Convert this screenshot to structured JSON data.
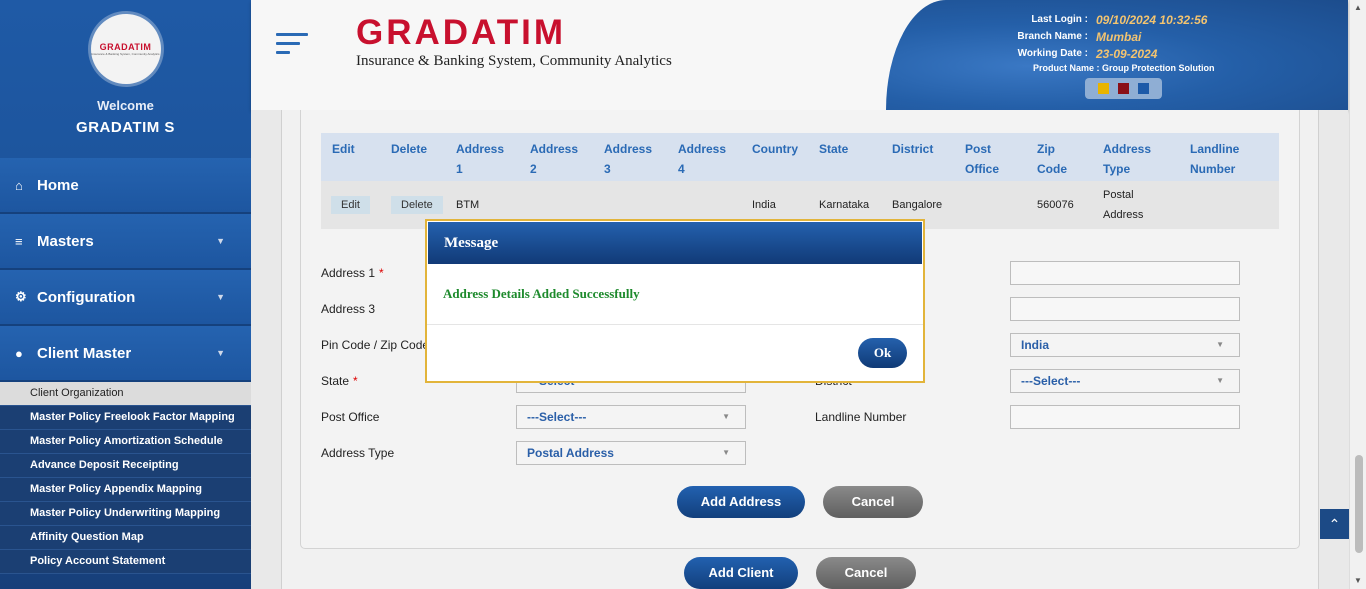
{
  "sidebar": {
    "logo_text": "GRADATIM",
    "logo_sub": "Insurance & Banking System, Community Analytics",
    "welcome": "Welcome",
    "username": "GRADATIM S",
    "nav": [
      {
        "label": "Home",
        "icon": "home-icon"
      },
      {
        "label": "Masters",
        "icon": "database-icon"
      },
      {
        "label": "Configuration",
        "icon": "gears-icon"
      },
      {
        "label": "Client Master",
        "icon": "user-icon"
      }
    ],
    "submenu": [
      "Client Organization",
      "Master Policy Freelook Factor Mapping",
      "Master Policy Amortization Schedule",
      "Advance Deposit Receipting",
      "Master Policy Appendix Mapping",
      "Master Policy Underwriting Mapping",
      "Affinity Question Map",
      "Policy Account Statement"
    ]
  },
  "header": {
    "brand": "GRADATIM",
    "tagline": "Insurance & Banking System, Community Analytics",
    "last_login_label": "Last Login :",
    "last_login": "09/10/2024 10:32:56",
    "branch_label": "Branch Name :",
    "branch": "Mumbai",
    "working_date_label": "Working Date :",
    "working_date": "23-09-2024",
    "product": "Product Name : Group Protection Solution",
    "theme_colors": [
      "#e8b400",
      "#8a0f17",
      "#1d5aa8"
    ]
  },
  "table": {
    "headers": [
      "Edit",
      "Delete",
      "Address 1",
      "Address 2",
      "Address 3",
      "Address 4",
      "Country",
      "State",
      "District",
      "Post Office",
      "Zip Code",
      "Address Type",
      "Landline Number"
    ],
    "rows": [
      {
        "edit": "Edit",
        "delete": "Delete",
        "address1": "BTM",
        "address2": "",
        "address3": "",
        "address4": "",
        "country": "India",
        "state": "Karnataka",
        "district": "Bangalore",
        "post_office": "",
        "zip": "560076",
        "type": "Postal Address",
        "landline": ""
      }
    ]
  },
  "form": {
    "address1_label": "Address 1",
    "address3_label": "Address 3",
    "pincode_label": "Pin Code / Zip Code",
    "state_label": "State",
    "state_value": "---Select---",
    "district_label": "District",
    "district_value": "---Select---",
    "country_value": "India",
    "post_office_label": "Post Office",
    "post_office_value": "---Select---",
    "landline_label": "Landline Number",
    "address_type_label": "Address Type",
    "address_type_value": "Postal Address",
    "required_mark": "*",
    "add_address": "Add Address",
    "cancel": "Cancel",
    "add_client": "Add Client",
    "cancel2": "Cancel"
  },
  "modal": {
    "title": "Message",
    "message": "Address Details Added Successfully",
    "ok": "Ok"
  }
}
